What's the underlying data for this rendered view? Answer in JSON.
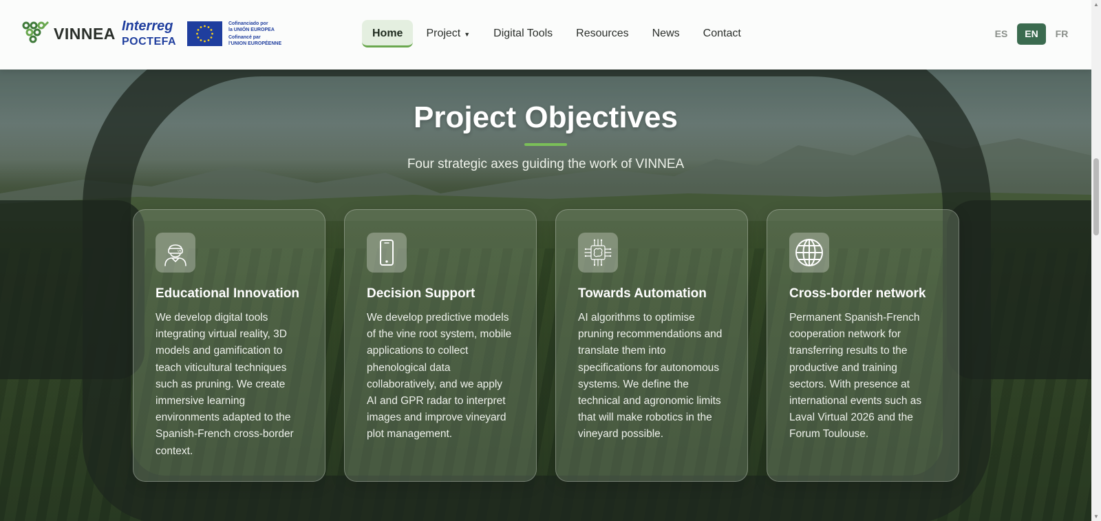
{
  "header": {
    "logo_text": "VINNEA",
    "partner": {
      "line1": "Interreg",
      "line2": "POCTEFA"
    },
    "eu_text": [
      "Cofinanciado por",
      "la UNIÓN EUROPEA",
      "Cofinancé par",
      "l'UNION EUROPÉENNE"
    ],
    "nav": [
      {
        "label": "Home",
        "active": true
      },
      {
        "label": "Project",
        "has_dropdown": true
      },
      {
        "label": "Digital Tools"
      },
      {
        "label": "Resources"
      },
      {
        "label": "News"
      },
      {
        "label": "Contact"
      }
    ],
    "languages": [
      {
        "label": "ES"
      },
      {
        "label": "EN",
        "active": true
      },
      {
        "label": "FR"
      }
    ]
  },
  "section": {
    "title": "Project Objectives",
    "subtitle": "Four strategic axes guiding the work of VINNEA",
    "accent_color": "#7bbf58"
  },
  "cards": [
    {
      "icon": "vr-headset-person-icon",
      "title": "Educational Innovation",
      "text": "We develop digital tools integrating virtual reality, 3D models and gamification to teach viticultural techniques such as pruning. We create immersive learning environments adapted to the Spanish-French cross-border context."
    },
    {
      "icon": "smartphone-icon",
      "title": "Decision Support",
      "text": "We develop predictive models of the vine root system, mobile applications to collect phenological data collaboratively, and we apply AI and GPR radar to interpret images and improve vineyard plot management."
    },
    {
      "icon": "ai-chip-brain-icon",
      "title": "Towards Automation",
      "text": "AI algorithms to optimise pruning recommendations and translate them into specifications for autonomous systems. We define the technical and agronomic limits that will make robotics in the vineyard possible."
    },
    {
      "icon": "globe-icon",
      "title": "Cross-border network",
      "text": "Permanent Spanish-French cooperation network for transferring results to the productive and training sectors. With presence at international events such as Laval Virtual 2026 and the Forum Toulouse."
    }
  ]
}
